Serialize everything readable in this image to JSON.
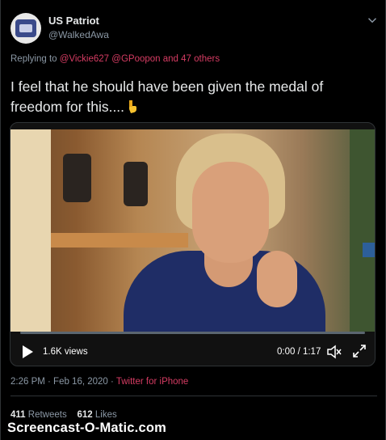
{
  "author": {
    "name": "US Patriot",
    "handle": "@WalkedAwa"
  },
  "reply": {
    "prefix": "Replying to ",
    "mention1": "@Vickie627",
    "mention2": "@GPoopon",
    "others": "and 47 others"
  },
  "tweet": {
    "text": "I feel that he should have been given the medal of freedom for this...."
  },
  "video": {
    "views": "1.6K views",
    "time": "0:00 / 1:17",
    "progress_fraction": 0
  },
  "meta": {
    "timestamp": "2:26 PM · Feb 16, 2020",
    "separator": " · ",
    "source": "Twitter for iPhone"
  },
  "stats": {
    "retweets_count": "411",
    "retweets_label": "Retweets",
    "likes_count": "612",
    "likes_label": "Likes"
  },
  "watermark": "Screencast-O-Matic.com",
  "colors": {
    "accent": "#d63c63",
    "background": "#000000",
    "muted": "#8b98a5"
  },
  "icons": [
    "chevron-down-icon",
    "pointing-down-emoji",
    "play-icon",
    "volume-icon",
    "fullscreen-icon"
  ]
}
